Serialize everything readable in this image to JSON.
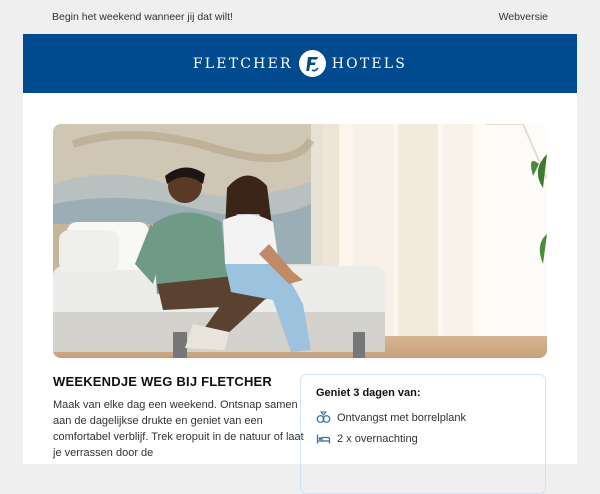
{
  "preheader": {
    "tagline": "Begin het weekend wanneer jij dat wilt!",
    "web_version_link": "Webversie"
  },
  "brand": {
    "word_left": "FLETCHER",
    "word_right": "HOTELS",
    "logo_letter": "F",
    "color": "#004a8f"
  },
  "hero": {
    "image_subject": "couple-on-hotel-bed-photo"
  },
  "article": {
    "heading": "WEEKENDJE WEG BIJ FLETCHER",
    "body": "Maak van elke dag een weekend. Ontsnap samen aan de dagelijkse drukte en geniet van een comfortabel verblijf. Trek eropuit in de natuur of laat je verrassen door de"
  },
  "benefits": {
    "title": "Geniet 3 dagen van:",
    "items": [
      {
        "icon": "cocktail-plate-icon",
        "label": "Ontvangst met borrelplank"
      },
      {
        "icon": "bed-icon",
        "label": "2 x overnachting"
      }
    ],
    "border_color": "#cfe4f1"
  }
}
